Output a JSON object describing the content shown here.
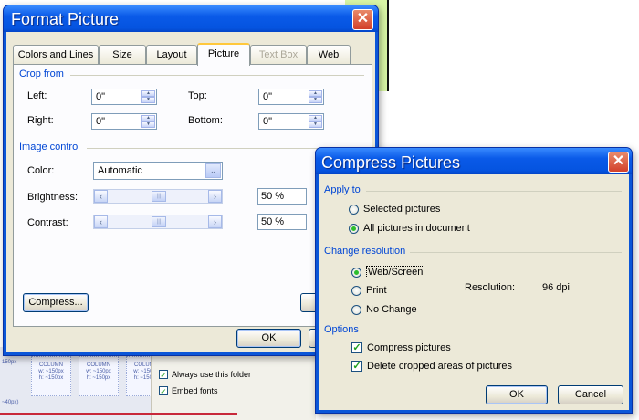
{
  "background": {
    "thumbs": [
      {
        "title": "COLUMN",
        "line1": "w: ~150px",
        "line2": "h: ~150px"
      },
      {
        "title": "COLUMN",
        "line1": "w: ~150px",
        "line2": "h: ~150px"
      },
      {
        "title": "COLUMN",
        "line1": "w: ~150px",
        "line2": "h: ~150px"
      }
    ],
    "left_edge_text": "-150px",
    "bottom_left_text": "~40px)",
    "always_use_folder": "Always use this folder",
    "embed_fonts": "Embed fonts"
  },
  "format_picture": {
    "title": "Format Picture",
    "close_glyph": "✕",
    "tabs": [
      {
        "label": "Colors and Lines"
      },
      {
        "label": "Size"
      },
      {
        "label": "Layout"
      },
      {
        "label": "Picture"
      },
      {
        "label": "Text Box"
      },
      {
        "label": "Web"
      }
    ],
    "active_tab": "Picture",
    "crop_group": "Crop from",
    "left_label": "Left:",
    "left_value": "0\"",
    "top_label": "Top:",
    "top_value": "0\"",
    "right_label": "Right:",
    "right_value": "0\"",
    "bottom_label": "Bottom:",
    "bottom_value": "0\"",
    "image_group": "Image control",
    "color_label": "Color:",
    "color_value": "Automatic",
    "brightness_label": "Brightness:",
    "brightness_value": "50 %",
    "brightness_level": 0.5,
    "contrast_label": "Contrast:",
    "contrast_value": "50 %",
    "contrast_level": 0.5,
    "compress_button": "Compress...",
    "ok_button": "OK"
  },
  "compress_pictures": {
    "title": "Compress Pictures",
    "close_glyph": "✕",
    "apply_group": "Apply to",
    "selected_pictures": "Selected pictures",
    "all_pictures": "All pictures in document",
    "apply_selected": "all",
    "resolution_group": "Change resolution",
    "web_screen": "Web/Screen",
    "print": "Print",
    "no_change": "No Change",
    "resolution_selected": "web",
    "resolution_label": "Resolution:",
    "resolution_value": "96 dpi",
    "options_group": "Options",
    "compress_pictures_option": "Compress pictures",
    "compress_checked": true,
    "delete_cropped": "Delete cropped areas of pictures",
    "delete_checked": true,
    "ok_button": "OK",
    "cancel_button": "Cancel"
  },
  "colors": {
    "titlebar": "#0554e0",
    "group_label": "#0046d5",
    "radio_dot": "#2dbe2d",
    "close_button": "#d2402a"
  }
}
